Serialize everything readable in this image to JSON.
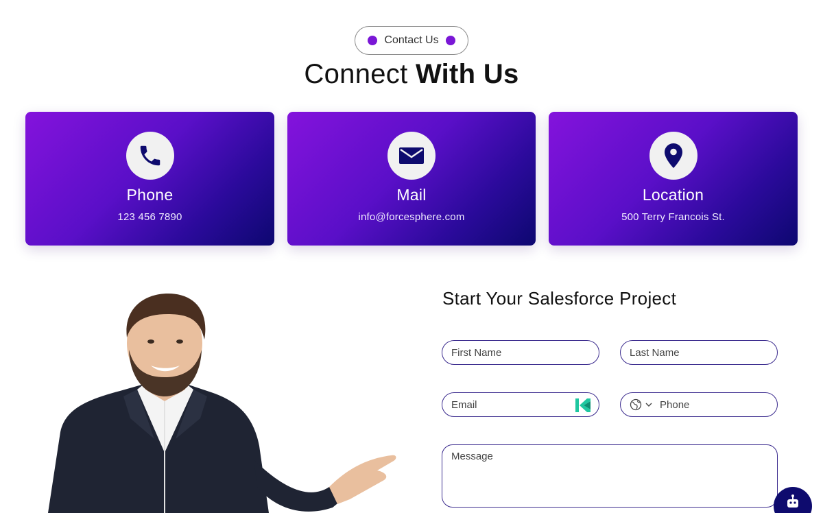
{
  "section": {
    "badge_label": "Contact Us",
    "heading_light": "Connect",
    "heading_bold": "With Us"
  },
  "cards": [
    {
      "title": "Phone",
      "value": "123 456 7890",
      "icon": "phone-icon"
    },
    {
      "title": "Mail",
      "value": "info@forcesphere.com",
      "icon": "mail-icon"
    },
    {
      "title": "Location",
      "value": "500 Terry Francois St.",
      "icon": "location-pin-icon"
    }
  ],
  "form": {
    "title": "Start Your Salesforce Project",
    "first_name_placeholder": "First Name",
    "last_name_placeholder": "Last Name",
    "email_placeholder": "Email",
    "phone_placeholder": "Phone",
    "message_placeholder": "Message"
  },
  "colors": {
    "accent_purple": "#7a17d6",
    "card_gradient_start": "#8413dc",
    "card_gradient_end": "#0d0870",
    "field_border": "#3b2b8e",
    "chat_button": "#0e0b6e"
  }
}
